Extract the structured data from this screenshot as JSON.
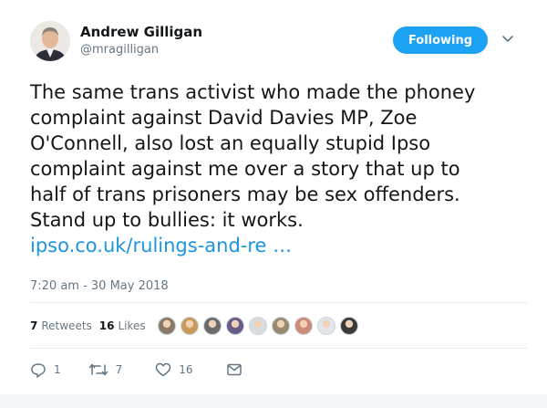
{
  "author": {
    "name": "Andrew Gilligan",
    "handle": "@mragilligan",
    "follow_label": "Following"
  },
  "tweet": {
    "lines": [
      "The same trans activist who made the phoney",
      "complaint against David Davies MP, Zoe",
      "O'Connell, also lost an equally stupid Ipso",
      "complaint against me over a story that up to",
      "half of trans prisoners may be sex offenders.",
      "Stand up to bullies: it works."
    ],
    "link_text": "ipso.co.uk/rulings-and-re …",
    "timestamp": "7:20 am - 30 May 2018"
  },
  "stats": {
    "retweets_count": "7",
    "retweets_label": "Retweets",
    "likes_count": "16",
    "likes_label": "Likes"
  },
  "liker_avatars": [
    {
      "color": "#8a7a6a"
    },
    {
      "color": "#c79a5a"
    },
    {
      "color": "#6b6b6b"
    },
    {
      "color": "#6a5a8a"
    },
    {
      "color": "#d8dde2"
    },
    {
      "color": "#9a8a70"
    },
    {
      "color": "#d08a7a"
    },
    {
      "color": "#e2e6ea"
    },
    {
      "color": "#3a3a3a"
    }
  ],
  "actions": {
    "reply_count": "1",
    "retweet_count": "7",
    "like_count": "16"
  },
  "colors": {
    "accent": "#1da1f2",
    "link": "#1b95e0",
    "muted": "#657786"
  }
}
